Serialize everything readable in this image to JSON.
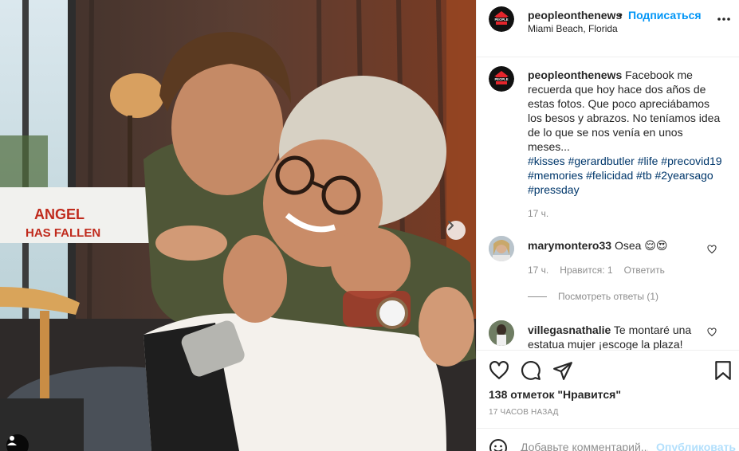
{
  "post": {
    "author": "peopleonthenews",
    "follow_label": "Подписаться",
    "separator": "•",
    "location": "Miami Beach, Florida"
  },
  "photo": {
    "sign_line1": "ANGEL",
    "sign_line2": "HAS FALLEN"
  },
  "caption": {
    "username": "peopleonthenews",
    "text": "Facebook me recuerda que hoy hace dos años de estas fotos. Que poco apreciábamos los besos y abrazos. No teníamos idea de lo que se nos venía en unos meses...",
    "hashtags": "#kisses #gerardbutler #life #precovid19 #memories #felicidad #tb #2yearsago #pressday",
    "time": "17 ч."
  },
  "comments": [
    {
      "username": "marymontero33",
      "text": "Osea 😌😍",
      "time": "17 ч.",
      "likes": "Нравится: 1",
      "reply_label": "Ответить",
      "view_replies": "Посмотреть ответы (1)"
    },
    {
      "username": "villegasnathalie",
      "text": "Te montaré una estatua mujer ¡escoge la plaza!"
    }
  ],
  "actions": {
    "likes_count": "138",
    "likes_label": "отметок \"Нравится\"",
    "time_ago": "17 ЧАСОВ НАЗАД"
  },
  "add_comment": {
    "placeholder": "Добавьте комментарий...",
    "publish_label": "Опубликовать"
  },
  "colors": {
    "link_blue": "#0095f6",
    "hashtag": "#00376b",
    "muted": "#8e8e8e",
    "border": "#efefef",
    "logo_red": "#e4252c"
  },
  "icons": {
    "more": "more-horizontal-icon",
    "like": "heart-icon",
    "comment": "comment-bubble-icon",
    "share": "paper-plane-icon",
    "save": "bookmark-icon",
    "emoji": "smiley-icon",
    "next": "chevron-right-icon",
    "tags": "user-tag-icon"
  }
}
